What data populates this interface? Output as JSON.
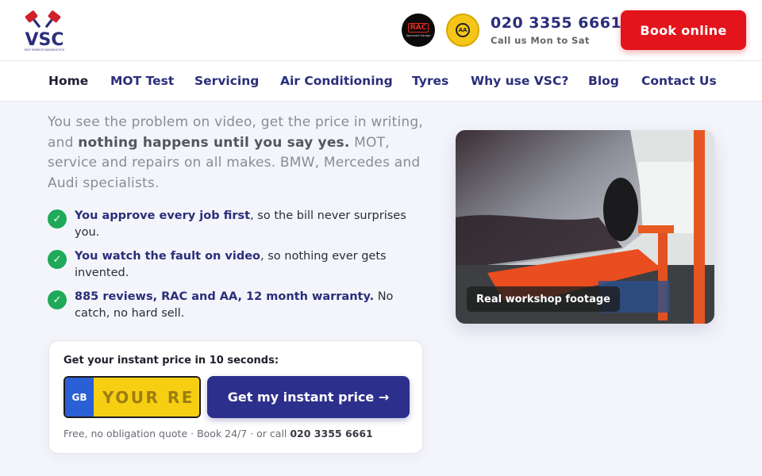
{
  "header": {
    "logo_text": "VSC",
    "logo_tagline": "MOT·SERVICE·DIAGNOSTICS",
    "rac_badge": {
      "word": "RAC",
      "sub": "Approved Garage"
    },
    "aa_badge": {
      "center": "AA",
      "ring_text": "CERTIFIED BY THE AA"
    },
    "phone": "020 3355 6661",
    "phone_sub": "Call us Mon to Sat",
    "book_label": "Book online"
  },
  "nav": {
    "items": [
      {
        "label": "Home",
        "active": true
      },
      {
        "label": "MOT Test"
      },
      {
        "label": "Servicing"
      },
      {
        "label": "Air Conditioning"
      },
      {
        "label": "Tyres"
      },
      {
        "label": "Why use VSC?"
      },
      {
        "label": "Blog"
      },
      {
        "label": "Contact Us"
      }
    ]
  },
  "intro": {
    "part1": "You see the problem on video, get the price in writing, and ",
    "bold": "nothing happens until you say yes.",
    "part2": " MOT, service and repairs on all makes. BMW, Mercedes and Audi specialists."
  },
  "benefits": [
    {
      "highlight": "You approve every job first",
      "rest": ", so the bill never surprises you."
    },
    {
      "highlight": "You watch the fault on video",
      "rest": ", so nothing ever gets invented."
    },
    {
      "highlight": "885 reviews, RAC and AA, 12 month warranty.",
      "rest": " No catch, no hard sell."
    }
  ],
  "quote": {
    "title": "Get your instant price in 10 seconds:",
    "plate_country": "GB",
    "plate_placeholder": "YOUR RE",
    "button_label": "Get my instant price →",
    "footer_text": "Free, no obligation quote · Book 24/7 · or call ",
    "footer_phone": "020 3355 6661"
  },
  "photo": {
    "caption": "Real workshop footage"
  },
  "colors": {
    "brand_navy": "#2b2e7a",
    "cta_red": "#e3141b",
    "button_navy": "#2d2f8c",
    "check_green": "#1faa5a",
    "plate_yellow": "#f7cf12",
    "plate_blue": "#2a5fd6"
  },
  "icons": {
    "check": "check-icon",
    "logo": "pistons-logo-icon"
  }
}
